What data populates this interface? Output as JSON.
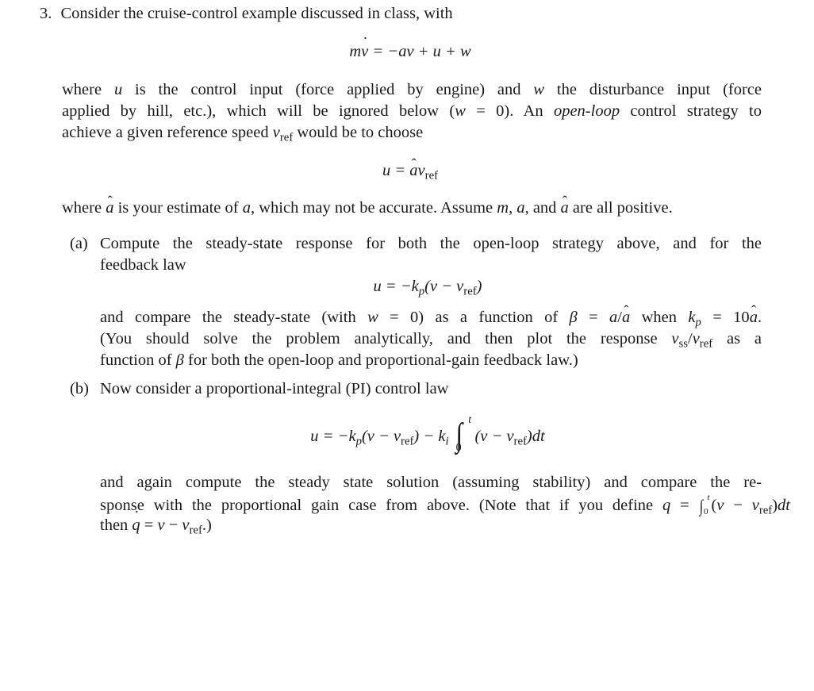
{
  "problem": {
    "number": "3.",
    "intro": "Consider the cruise-control example discussed in class, with",
    "eq1": "mv̇ = −av + u + w",
    "para1": [
      "where u is the control input (force applied by engine) and w the disturbance input (force",
      "applied by hill, etc.), which will be ignored below (w = 0). An open-loop control strategy to",
      "achieve a given reference speed v_ref would be to choose"
    ],
    "eq2": "u = âv_ref",
    "para2": "where â is your estimate of a, which may not be accurate. Assume m, a, and â are all positive.",
    "parts": [
      {
        "label": "(a)",
        "text_lines": [
          "Compute the steady-state response for both the open-loop strategy above, and for the",
          "feedback law"
        ],
        "equation": "u = −k_p(v − v_ref)",
        "after_lines": [
          "and compare the steady-state (with w = 0) as a function of β = a/â when k_p = 10â.",
          "(You should solve the problem analytically, and then plot the response v_ss/v_ref as a",
          "function of β for both the open-loop and proportional-gain feedback law.)"
        ]
      },
      {
        "label": "(b)",
        "text_lines": [
          "Now consider a proportional-integral (PI) control law"
        ],
        "equation": "u = −k_p(v − v_ref) − k_i ∫_0^t (v − v_ref)dt",
        "after_lines": [
          "and again compute the steady state solution (assuming stability) and compare the re-",
          "sponse with the proportional gain case from above. (Note that if you define q = ∫_0^t(v − v_ref)dt",
          "then q̇ = v − v_ref.)"
        ]
      }
    ]
  },
  "words": {
    "where": "where",
    "is_the_control": "is the control input (force applied by engine) and",
    "the_disturbance": "the disturbance input (force",
    "applied_by_hill": "applied by hill, etc.), which will be ignored below (",
    "eq0_close": " = 0). An ",
    "open_loop": "open-loop",
    "control_strategy": " control strategy to",
    "achieve": "achieve a given reference speed",
    "would_be": "would be to choose",
    "ref": "ref",
    "ss": "ss",
    "is_your_estimate": "is your estimate of",
    "which_may": ", which may not be accurate. Assume",
    "and": ", and",
    "are_all_positive": "are all positive.",
    "and_compare": "and compare the steady-state (with",
    "as_function_of": " = 0) as a function of",
    "when": "when",
    "you_should": "(You should solve the problem analytically, and then plot the response",
    "as_a": "as a",
    "function_of": "function of",
    "for_both": "for both the open-loop and proportional-gain feedback law.)",
    "and_again": "and again compute the steady state solution (assuming stability) and compare the re-",
    "sponse_with": "sponse with the proportional gain case from above. (Note that if you define",
    "then": "then"
  }
}
